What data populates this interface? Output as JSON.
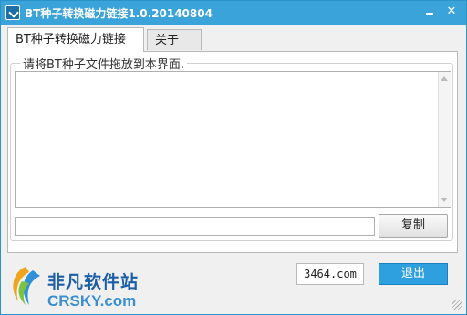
{
  "window": {
    "title": "BT种子转换磁力链接1.0.20140804",
    "minimize_icon": "minimize-icon",
    "close_icon": "close-icon",
    "close_glyph": "✕"
  },
  "tabs": [
    {
      "label": "BT种子转换磁力链接",
      "active": true
    },
    {
      "label": "关于",
      "active": false
    }
  ],
  "drop_area": {
    "legend": "请将BT种子文件拖放到本界面.",
    "value": ""
  },
  "result": {
    "value": "",
    "copy_label": "复制"
  },
  "footer": {
    "site_label": "3464.com",
    "exit_label": "退出"
  },
  "watermark": {
    "name_cn": "非凡软件站",
    "name_en": "CRSKY.com"
  },
  "colors": {
    "titlebar": "#3aa3d9",
    "accent_button": "#2e9fdf"
  }
}
